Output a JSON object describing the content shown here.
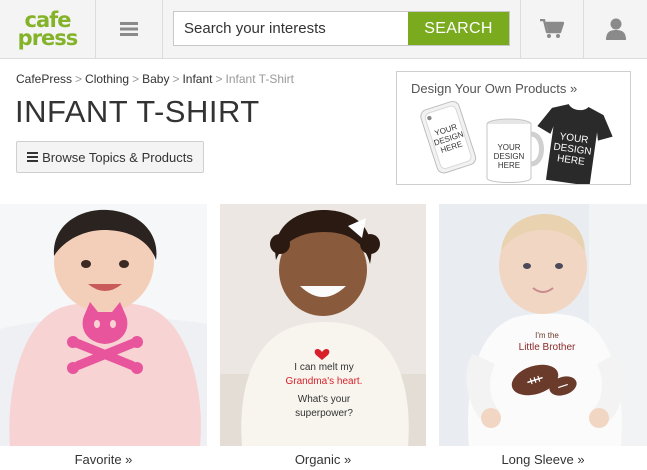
{
  "header": {
    "logo_line1": "cafe",
    "logo_line2": "press",
    "search_placeholder": "Search your interests",
    "search_button": "SEARCH",
    "icons": [
      "hamburger-menu-icon",
      "cart-icon",
      "user-icon"
    ]
  },
  "breadcrumb": [
    {
      "label": "CafePress"
    },
    {
      "label": "Clothing"
    },
    {
      "label": "Baby"
    },
    {
      "label": "Infant"
    },
    {
      "label": "Infant T-Shirt"
    }
  ],
  "page_title": "INFANT T-SHIRT",
  "browse_button": "Browse Topics & Products",
  "promo": {
    "title": "Design Your Own Products »",
    "mock_text": "YOUR DESIGN HERE"
  },
  "products": [
    {
      "label": "Favorite »",
      "shirt_graphic": "pink-cat-skull-crossbones"
    },
    {
      "label": "Organic »",
      "shirt_line1": "I can melt my",
      "shirt_line2": "Grandma's heart.",
      "shirt_line3": "What's your",
      "shirt_line4": "superpower?"
    },
    {
      "label": "Long Sleeve »",
      "shirt_line1": "I'm the",
      "shirt_line2": "Little Brother"
    }
  ],
  "colors": {
    "brand_green": "#7aab1e",
    "logo_green": "#84b32a",
    "header_bg": "#f4f4f4",
    "icon_gray": "#8a8a8a",
    "cat_pink": "#e8559c"
  }
}
